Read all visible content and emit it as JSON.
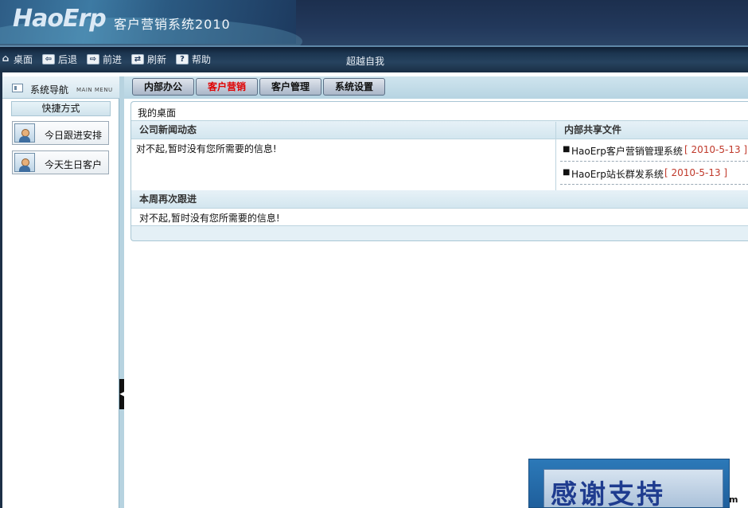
{
  "header": {
    "logo": "HaoErp",
    "subtitle": "客户营销系统2010"
  },
  "toolbar": {
    "items": [
      {
        "icon": "home-icon",
        "label": "桌面"
      },
      {
        "icon": "back-arrow-icon",
        "label": "后退"
      },
      {
        "icon": "forward-arrow-icon",
        "label": "前进"
      },
      {
        "icon": "refresh-icon",
        "label": "刷新"
      },
      {
        "icon": "help-icon",
        "label": "帮助"
      }
    ],
    "slogan": "超越自我"
  },
  "sidebar": {
    "title": "系统导航",
    "title_en": "MAIN MENU",
    "shortcut_header": "快捷方式",
    "shortcuts": [
      {
        "icon": "user-icon",
        "label": "今日跟进安排"
      },
      {
        "icon": "user-icon",
        "label": "今天生日客户"
      }
    ]
  },
  "tabs": [
    {
      "label": "内部办公",
      "active": false
    },
    {
      "label": "客户营销",
      "active": true
    },
    {
      "label": "客户管理",
      "active": false
    },
    {
      "label": "系统设置",
      "active": false
    }
  ],
  "desktop": {
    "title": "我的桌面",
    "news": {
      "header": "公司新闻动态",
      "message": "对不起,暂时没有您所需要的信息!"
    },
    "files": {
      "header": "内部共享文件",
      "items": [
        {
          "name": "HaoErp客户营销管理系统",
          "date": "[ 2010-5-13 ]"
        },
        {
          "name": "HaoErp站长群发系统",
          "date": "[ 2010-5-13 ]"
        }
      ]
    },
    "followup": {
      "header": "本周再次跟进",
      "message": "对不起,暂时没有您所需要的信息!"
    }
  },
  "badge": {
    "text": "感谢支持",
    "tail": "m"
  },
  "colors": {
    "active_tab_text": "#e00000",
    "file_date": "#c0392b",
    "header_bg": "#22385b"
  }
}
